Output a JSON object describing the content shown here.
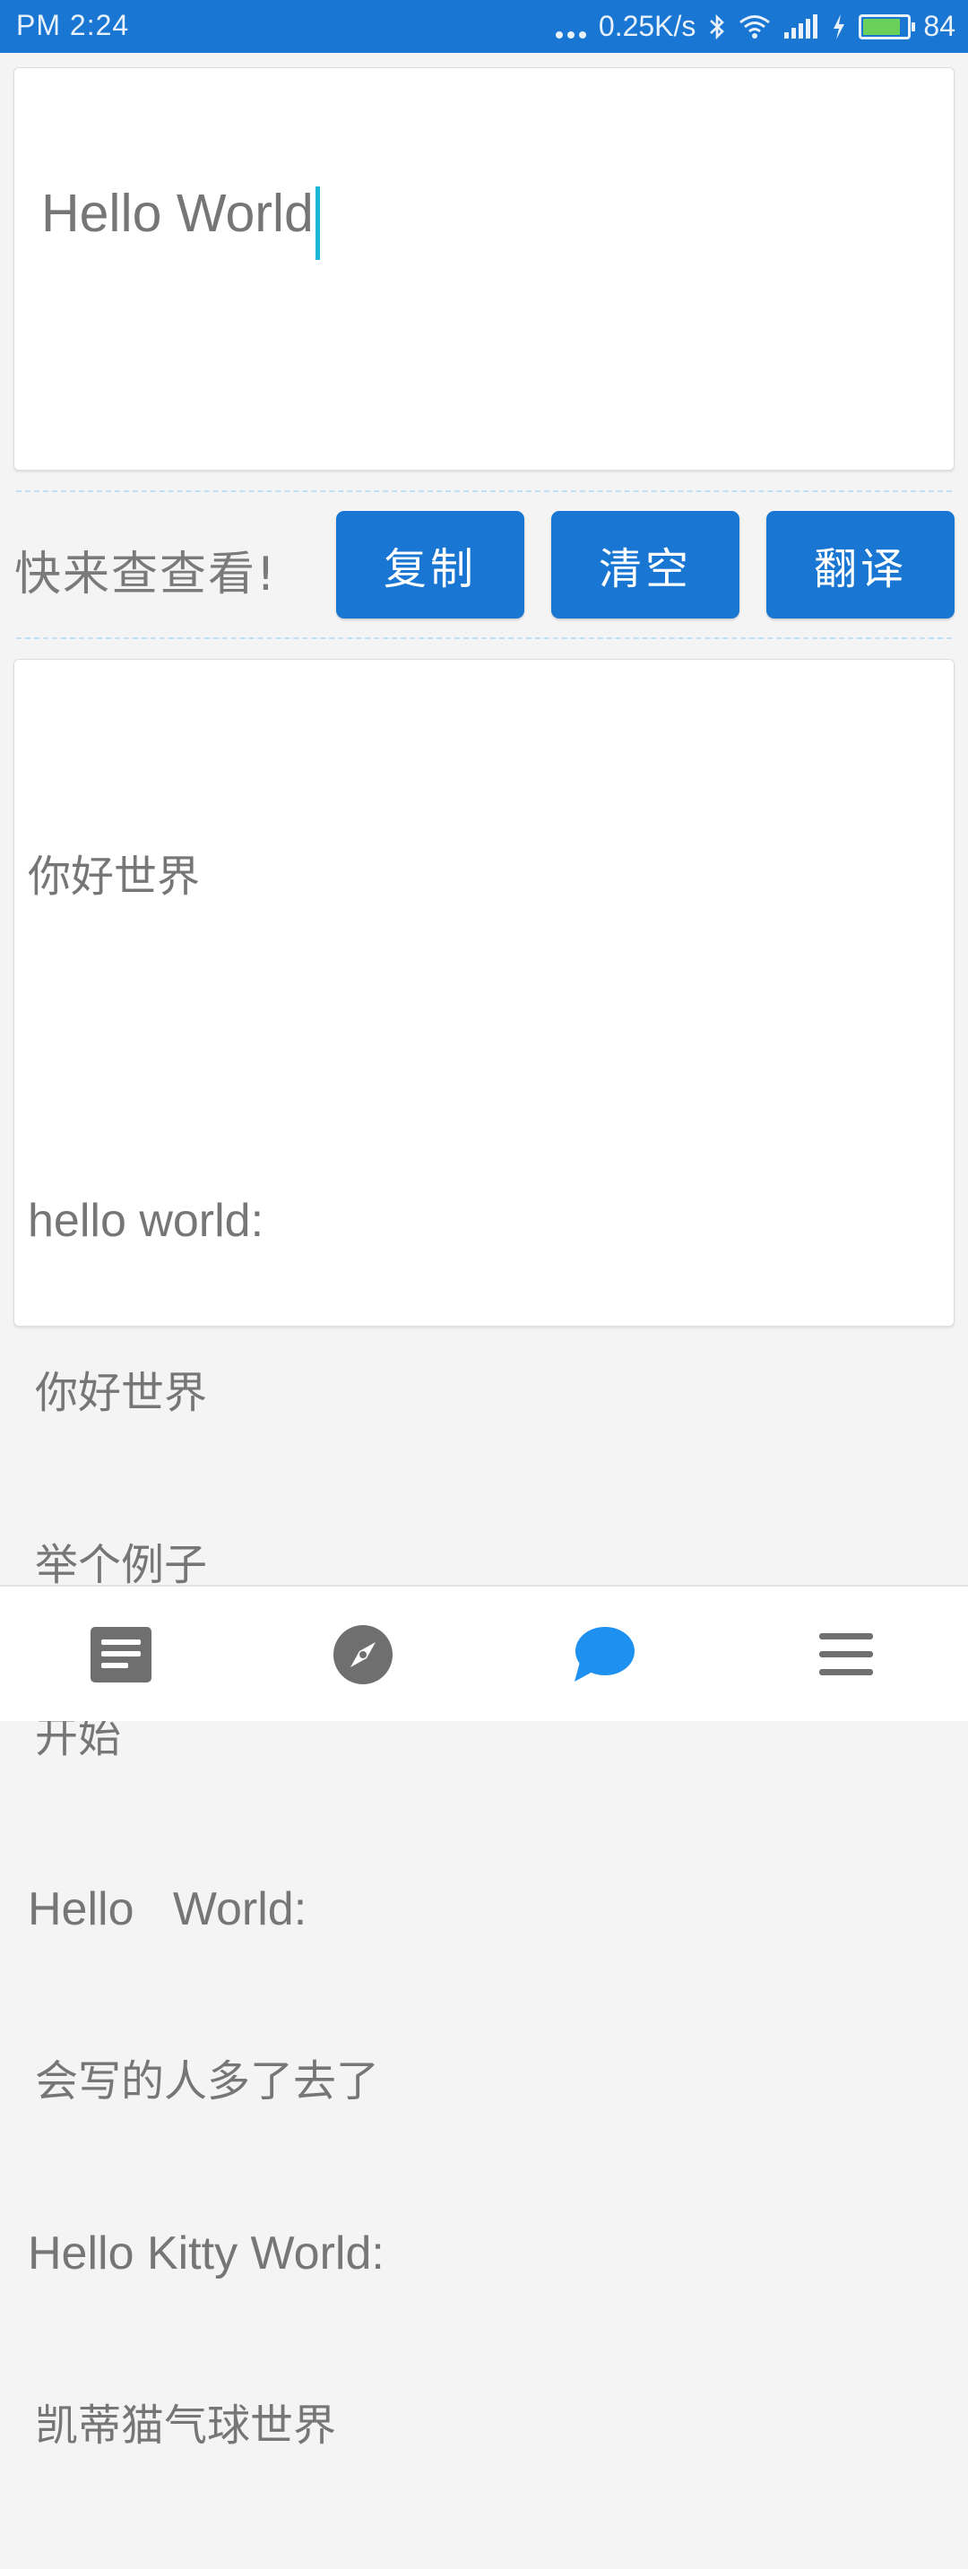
{
  "status_bar": {
    "time": "PM  2:24",
    "network_speed": "0.25K/s",
    "battery_level": "84",
    "icons": [
      "more-dots-icon",
      "bluetooth-icon",
      "wifi-icon",
      "signal-icon",
      "charging-icon",
      "battery-icon"
    ]
  },
  "input": {
    "text": "Hello World"
  },
  "toolbar": {
    "hint": "快来查查看!",
    "copy_label": "复制",
    "clear_label": "清空",
    "translate_label": "翻译"
  },
  "output": {
    "translation": "你好世界",
    "entries": [
      {
        "term": "hello world:",
        "meanings": [
          "你好世界",
          "举个例子",
          "开始"
        ]
      },
      {
        "term": "Hello   World:",
        "meanings": [
          "会写的人多了去了"
        ]
      },
      {
        "term": "Hello Kitty World:",
        "meanings": [
          "凯蒂猫气球世界"
        ]
      }
    ]
  },
  "bottom_nav": {
    "items": [
      {
        "icon": "article-icon",
        "active": false
      },
      {
        "icon": "compass-icon",
        "active": false
      },
      {
        "icon": "chat-bubble-icon",
        "active": true
      },
      {
        "icon": "menu-icon",
        "active": false
      }
    ],
    "colors": {
      "active": "#1e90f0",
      "inactive": "#6f6f6f"
    }
  },
  "colors": {
    "primary": "#1976d2",
    "cursor": "#1ab8d6",
    "battery_fill": "#6ad05a"
  }
}
